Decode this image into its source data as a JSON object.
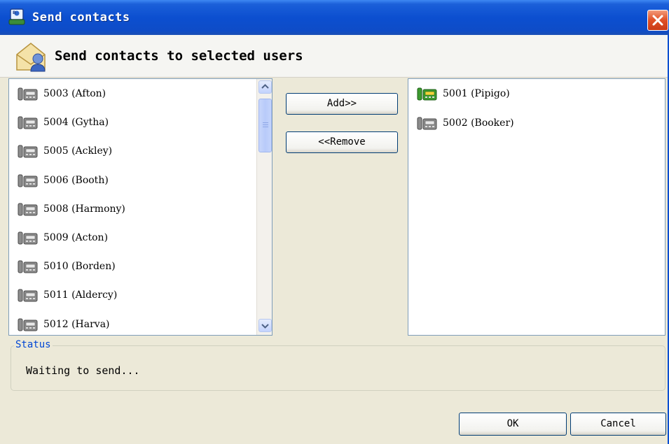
{
  "window": {
    "title": "Send contacts"
  },
  "header": {
    "title": "Send contacts to selected users"
  },
  "available_contacts": [
    {
      "label": "5003 (Afton)",
      "icon": "phone-gray-icon"
    },
    {
      "label": "5004 (Gytha)",
      "icon": "phone-gray-icon"
    },
    {
      "label": "5005 (Ackley)",
      "icon": "phone-gray-icon"
    },
    {
      "label": "5006 (Booth)",
      "icon": "phone-gray-icon"
    },
    {
      "label": "5008 (Harmony)",
      "icon": "phone-gray-icon"
    },
    {
      "label": "5009 (Acton)",
      "icon": "phone-gray-icon"
    },
    {
      "label": "5010 (Borden)",
      "icon": "phone-gray-icon"
    },
    {
      "label": "5011 (Aldercy)",
      "icon": "phone-gray-icon"
    },
    {
      "label": "5012 (Harva)",
      "icon": "phone-gray-icon"
    }
  ],
  "selected_users": [
    {
      "label": "5001 (Pipigo)",
      "icon": "phone-green-icon"
    },
    {
      "label": "5002 (Booker)",
      "icon": "phone-gray-icon"
    }
  ],
  "buttons": {
    "add": "Add>>",
    "remove": "<<Remove",
    "ok": "OK",
    "cancel": "Cancel"
  },
  "status": {
    "legend": "Status",
    "text": "Waiting to send..."
  },
  "colors": {
    "titlebar": "#0c4fd0",
    "close": "#e04f25",
    "legend": "#0046d5",
    "dialog": "#ece9d8"
  }
}
